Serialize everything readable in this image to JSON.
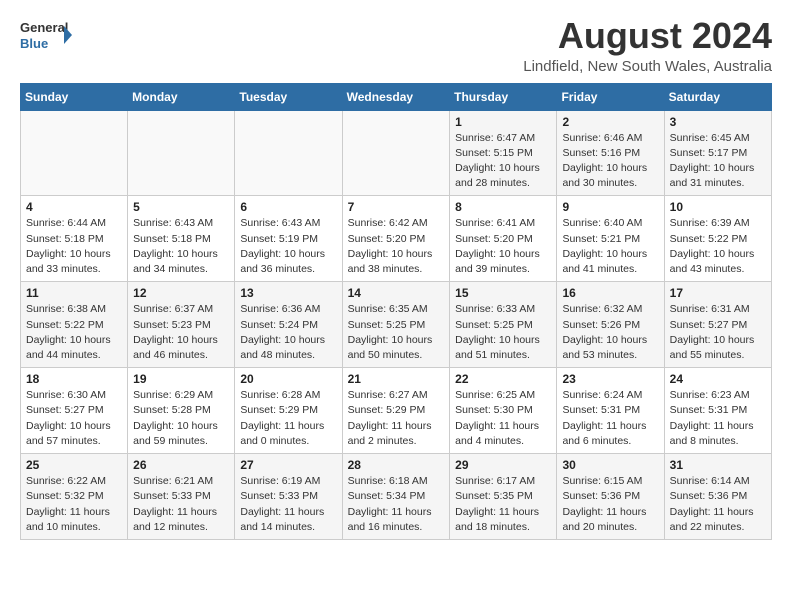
{
  "header": {
    "logo_line1": "General",
    "logo_line2": "Blue",
    "title": "August 2024",
    "subtitle": "Lindfield, New South Wales, Australia"
  },
  "weekdays": [
    "Sunday",
    "Monday",
    "Tuesday",
    "Wednesday",
    "Thursday",
    "Friday",
    "Saturday"
  ],
  "weeks": [
    [
      {
        "day": "",
        "info": ""
      },
      {
        "day": "",
        "info": ""
      },
      {
        "day": "",
        "info": ""
      },
      {
        "day": "",
        "info": ""
      },
      {
        "day": "1",
        "info": "Sunrise: 6:47 AM\nSunset: 5:15 PM\nDaylight: 10 hours\nand 28 minutes."
      },
      {
        "day": "2",
        "info": "Sunrise: 6:46 AM\nSunset: 5:16 PM\nDaylight: 10 hours\nand 30 minutes."
      },
      {
        "day": "3",
        "info": "Sunrise: 6:45 AM\nSunset: 5:17 PM\nDaylight: 10 hours\nand 31 minutes."
      }
    ],
    [
      {
        "day": "4",
        "info": "Sunrise: 6:44 AM\nSunset: 5:18 PM\nDaylight: 10 hours\nand 33 minutes."
      },
      {
        "day": "5",
        "info": "Sunrise: 6:43 AM\nSunset: 5:18 PM\nDaylight: 10 hours\nand 34 minutes."
      },
      {
        "day": "6",
        "info": "Sunrise: 6:43 AM\nSunset: 5:19 PM\nDaylight: 10 hours\nand 36 minutes."
      },
      {
        "day": "7",
        "info": "Sunrise: 6:42 AM\nSunset: 5:20 PM\nDaylight: 10 hours\nand 38 minutes."
      },
      {
        "day": "8",
        "info": "Sunrise: 6:41 AM\nSunset: 5:20 PM\nDaylight: 10 hours\nand 39 minutes."
      },
      {
        "day": "9",
        "info": "Sunrise: 6:40 AM\nSunset: 5:21 PM\nDaylight: 10 hours\nand 41 minutes."
      },
      {
        "day": "10",
        "info": "Sunrise: 6:39 AM\nSunset: 5:22 PM\nDaylight: 10 hours\nand 43 minutes."
      }
    ],
    [
      {
        "day": "11",
        "info": "Sunrise: 6:38 AM\nSunset: 5:22 PM\nDaylight: 10 hours\nand 44 minutes."
      },
      {
        "day": "12",
        "info": "Sunrise: 6:37 AM\nSunset: 5:23 PM\nDaylight: 10 hours\nand 46 minutes."
      },
      {
        "day": "13",
        "info": "Sunrise: 6:36 AM\nSunset: 5:24 PM\nDaylight: 10 hours\nand 48 minutes."
      },
      {
        "day": "14",
        "info": "Sunrise: 6:35 AM\nSunset: 5:25 PM\nDaylight: 10 hours\nand 50 minutes."
      },
      {
        "day": "15",
        "info": "Sunrise: 6:33 AM\nSunset: 5:25 PM\nDaylight: 10 hours\nand 51 minutes."
      },
      {
        "day": "16",
        "info": "Sunrise: 6:32 AM\nSunset: 5:26 PM\nDaylight: 10 hours\nand 53 minutes."
      },
      {
        "day": "17",
        "info": "Sunrise: 6:31 AM\nSunset: 5:27 PM\nDaylight: 10 hours\nand 55 minutes."
      }
    ],
    [
      {
        "day": "18",
        "info": "Sunrise: 6:30 AM\nSunset: 5:27 PM\nDaylight: 10 hours\nand 57 minutes."
      },
      {
        "day": "19",
        "info": "Sunrise: 6:29 AM\nSunset: 5:28 PM\nDaylight: 10 hours\nand 59 minutes."
      },
      {
        "day": "20",
        "info": "Sunrise: 6:28 AM\nSunset: 5:29 PM\nDaylight: 11 hours\nand 0 minutes."
      },
      {
        "day": "21",
        "info": "Sunrise: 6:27 AM\nSunset: 5:29 PM\nDaylight: 11 hours\nand 2 minutes."
      },
      {
        "day": "22",
        "info": "Sunrise: 6:25 AM\nSunset: 5:30 PM\nDaylight: 11 hours\nand 4 minutes."
      },
      {
        "day": "23",
        "info": "Sunrise: 6:24 AM\nSunset: 5:31 PM\nDaylight: 11 hours\nand 6 minutes."
      },
      {
        "day": "24",
        "info": "Sunrise: 6:23 AM\nSunset: 5:31 PM\nDaylight: 11 hours\nand 8 minutes."
      }
    ],
    [
      {
        "day": "25",
        "info": "Sunrise: 6:22 AM\nSunset: 5:32 PM\nDaylight: 11 hours\nand 10 minutes."
      },
      {
        "day": "26",
        "info": "Sunrise: 6:21 AM\nSunset: 5:33 PM\nDaylight: 11 hours\nand 12 minutes."
      },
      {
        "day": "27",
        "info": "Sunrise: 6:19 AM\nSunset: 5:33 PM\nDaylight: 11 hours\nand 14 minutes."
      },
      {
        "day": "28",
        "info": "Sunrise: 6:18 AM\nSunset: 5:34 PM\nDaylight: 11 hours\nand 16 minutes."
      },
      {
        "day": "29",
        "info": "Sunrise: 6:17 AM\nSunset: 5:35 PM\nDaylight: 11 hours\nand 18 minutes."
      },
      {
        "day": "30",
        "info": "Sunrise: 6:15 AM\nSunset: 5:36 PM\nDaylight: 11 hours\nand 20 minutes."
      },
      {
        "day": "31",
        "info": "Sunrise: 6:14 AM\nSunset: 5:36 PM\nDaylight: 11 hours\nand 22 minutes."
      }
    ]
  ]
}
